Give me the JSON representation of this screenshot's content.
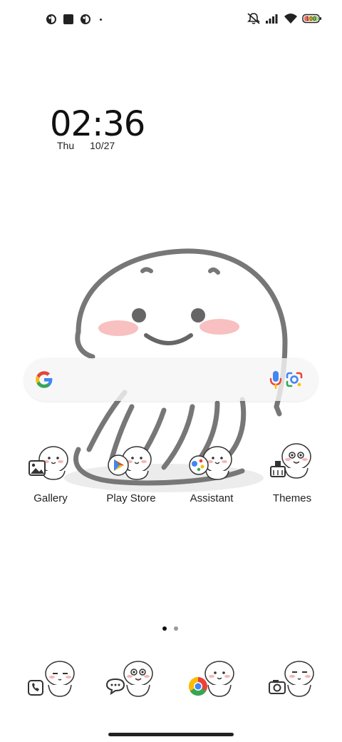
{
  "status_bar": {
    "left_icons": [
      "notification-icon",
      "square-notification-icon",
      "notification-icon",
      "more-dot"
    ],
    "right_icons": [
      "mute-icon",
      "signal-icon",
      "wifi-icon",
      "battery-icon"
    ],
    "battery_level": "100"
  },
  "clock": {
    "time": "02:36",
    "day": "Thu",
    "date": "10/27"
  },
  "search_bar": {
    "icons": [
      "google-icon",
      "mic-icon",
      "lens-icon"
    ]
  },
  "apps": [
    {
      "label": "Gallery",
      "icon": "gallery-icon"
    },
    {
      "label": "Play Store",
      "icon": "play-store-icon"
    },
    {
      "label": "Assistant",
      "icon": "assistant-icon"
    },
    {
      "label": "Themes",
      "icon": "themes-icon"
    }
  ],
  "pages": {
    "count": 2,
    "current": 1
  },
  "dock": [
    {
      "icon": "phone-icon"
    },
    {
      "icon": "messages-icon"
    },
    {
      "icon": "chrome-icon"
    },
    {
      "icon": "camera-icon"
    }
  ],
  "colors": {
    "google_blue": "#4285F4",
    "google_red": "#EA4335",
    "google_yellow": "#FBBC05",
    "google_green": "#34A853",
    "blush": "#f7b5b5"
  }
}
